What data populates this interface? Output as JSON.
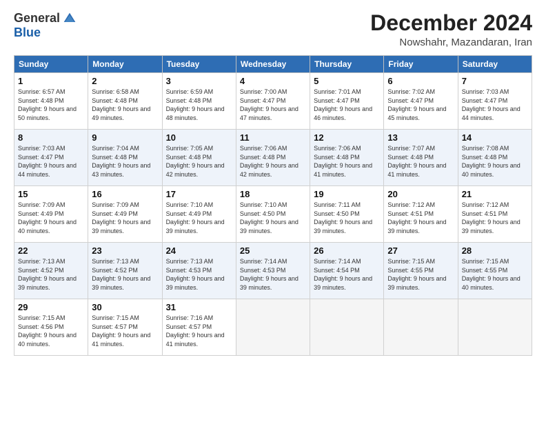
{
  "logo": {
    "general": "General",
    "blue": "Blue"
  },
  "header": {
    "month": "December 2024",
    "location": "Nowshahr, Mazandaran, Iran"
  },
  "weekdays": [
    "Sunday",
    "Monday",
    "Tuesday",
    "Wednesday",
    "Thursday",
    "Friday",
    "Saturday"
  ],
  "weeks": [
    [
      {
        "day": "1",
        "sunrise": "Sunrise: 6:57 AM",
        "sunset": "Sunset: 4:48 PM",
        "daylight": "Daylight: 9 hours and 50 minutes."
      },
      {
        "day": "2",
        "sunrise": "Sunrise: 6:58 AM",
        "sunset": "Sunset: 4:48 PM",
        "daylight": "Daylight: 9 hours and 49 minutes."
      },
      {
        "day": "3",
        "sunrise": "Sunrise: 6:59 AM",
        "sunset": "Sunset: 4:48 PM",
        "daylight": "Daylight: 9 hours and 48 minutes."
      },
      {
        "day": "4",
        "sunrise": "Sunrise: 7:00 AM",
        "sunset": "Sunset: 4:47 PM",
        "daylight": "Daylight: 9 hours and 47 minutes."
      },
      {
        "day": "5",
        "sunrise": "Sunrise: 7:01 AM",
        "sunset": "Sunset: 4:47 PM",
        "daylight": "Daylight: 9 hours and 46 minutes."
      },
      {
        "day": "6",
        "sunrise": "Sunrise: 7:02 AM",
        "sunset": "Sunset: 4:47 PM",
        "daylight": "Daylight: 9 hours and 45 minutes."
      },
      {
        "day": "7",
        "sunrise": "Sunrise: 7:03 AM",
        "sunset": "Sunset: 4:47 PM",
        "daylight": "Daylight: 9 hours and 44 minutes."
      }
    ],
    [
      {
        "day": "8",
        "sunrise": "Sunrise: 7:03 AM",
        "sunset": "Sunset: 4:47 PM",
        "daylight": "Daylight: 9 hours and 44 minutes."
      },
      {
        "day": "9",
        "sunrise": "Sunrise: 7:04 AM",
        "sunset": "Sunset: 4:48 PM",
        "daylight": "Daylight: 9 hours and 43 minutes."
      },
      {
        "day": "10",
        "sunrise": "Sunrise: 7:05 AM",
        "sunset": "Sunset: 4:48 PM",
        "daylight": "Daylight: 9 hours and 42 minutes."
      },
      {
        "day": "11",
        "sunrise": "Sunrise: 7:06 AM",
        "sunset": "Sunset: 4:48 PM",
        "daylight": "Daylight: 9 hours and 42 minutes."
      },
      {
        "day": "12",
        "sunrise": "Sunrise: 7:06 AM",
        "sunset": "Sunset: 4:48 PM",
        "daylight": "Daylight: 9 hours and 41 minutes."
      },
      {
        "day": "13",
        "sunrise": "Sunrise: 7:07 AM",
        "sunset": "Sunset: 4:48 PM",
        "daylight": "Daylight: 9 hours and 41 minutes."
      },
      {
        "day": "14",
        "sunrise": "Sunrise: 7:08 AM",
        "sunset": "Sunset: 4:48 PM",
        "daylight": "Daylight: 9 hours and 40 minutes."
      }
    ],
    [
      {
        "day": "15",
        "sunrise": "Sunrise: 7:09 AM",
        "sunset": "Sunset: 4:49 PM",
        "daylight": "Daylight: 9 hours and 40 minutes."
      },
      {
        "day": "16",
        "sunrise": "Sunrise: 7:09 AM",
        "sunset": "Sunset: 4:49 PM",
        "daylight": "Daylight: 9 hours and 39 minutes."
      },
      {
        "day": "17",
        "sunrise": "Sunrise: 7:10 AM",
        "sunset": "Sunset: 4:49 PM",
        "daylight": "Daylight: 9 hours and 39 minutes."
      },
      {
        "day": "18",
        "sunrise": "Sunrise: 7:10 AM",
        "sunset": "Sunset: 4:50 PM",
        "daylight": "Daylight: 9 hours and 39 minutes."
      },
      {
        "day": "19",
        "sunrise": "Sunrise: 7:11 AM",
        "sunset": "Sunset: 4:50 PM",
        "daylight": "Daylight: 9 hours and 39 minutes."
      },
      {
        "day": "20",
        "sunrise": "Sunrise: 7:12 AM",
        "sunset": "Sunset: 4:51 PM",
        "daylight": "Daylight: 9 hours and 39 minutes."
      },
      {
        "day": "21",
        "sunrise": "Sunrise: 7:12 AM",
        "sunset": "Sunset: 4:51 PM",
        "daylight": "Daylight: 9 hours and 39 minutes."
      }
    ],
    [
      {
        "day": "22",
        "sunrise": "Sunrise: 7:13 AM",
        "sunset": "Sunset: 4:52 PM",
        "daylight": "Daylight: 9 hours and 39 minutes."
      },
      {
        "day": "23",
        "sunrise": "Sunrise: 7:13 AM",
        "sunset": "Sunset: 4:52 PM",
        "daylight": "Daylight: 9 hours and 39 minutes."
      },
      {
        "day": "24",
        "sunrise": "Sunrise: 7:13 AM",
        "sunset": "Sunset: 4:53 PM",
        "daylight": "Daylight: 9 hours and 39 minutes."
      },
      {
        "day": "25",
        "sunrise": "Sunrise: 7:14 AM",
        "sunset": "Sunset: 4:53 PM",
        "daylight": "Daylight: 9 hours and 39 minutes."
      },
      {
        "day": "26",
        "sunrise": "Sunrise: 7:14 AM",
        "sunset": "Sunset: 4:54 PM",
        "daylight": "Daylight: 9 hours and 39 minutes."
      },
      {
        "day": "27",
        "sunrise": "Sunrise: 7:15 AM",
        "sunset": "Sunset: 4:55 PM",
        "daylight": "Daylight: 9 hours and 39 minutes."
      },
      {
        "day": "28",
        "sunrise": "Sunrise: 7:15 AM",
        "sunset": "Sunset: 4:55 PM",
        "daylight": "Daylight: 9 hours and 40 minutes."
      }
    ],
    [
      {
        "day": "29",
        "sunrise": "Sunrise: 7:15 AM",
        "sunset": "Sunset: 4:56 PM",
        "daylight": "Daylight: 9 hours and 40 minutes."
      },
      {
        "day": "30",
        "sunrise": "Sunrise: 7:15 AM",
        "sunset": "Sunset: 4:57 PM",
        "daylight": "Daylight: 9 hours and 41 minutes."
      },
      {
        "day": "31",
        "sunrise": "Sunrise: 7:16 AM",
        "sunset": "Sunset: 4:57 PM",
        "daylight": "Daylight: 9 hours and 41 minutes."
      },
      null,
      null,
      null,
      null
    ]
  ]
}
